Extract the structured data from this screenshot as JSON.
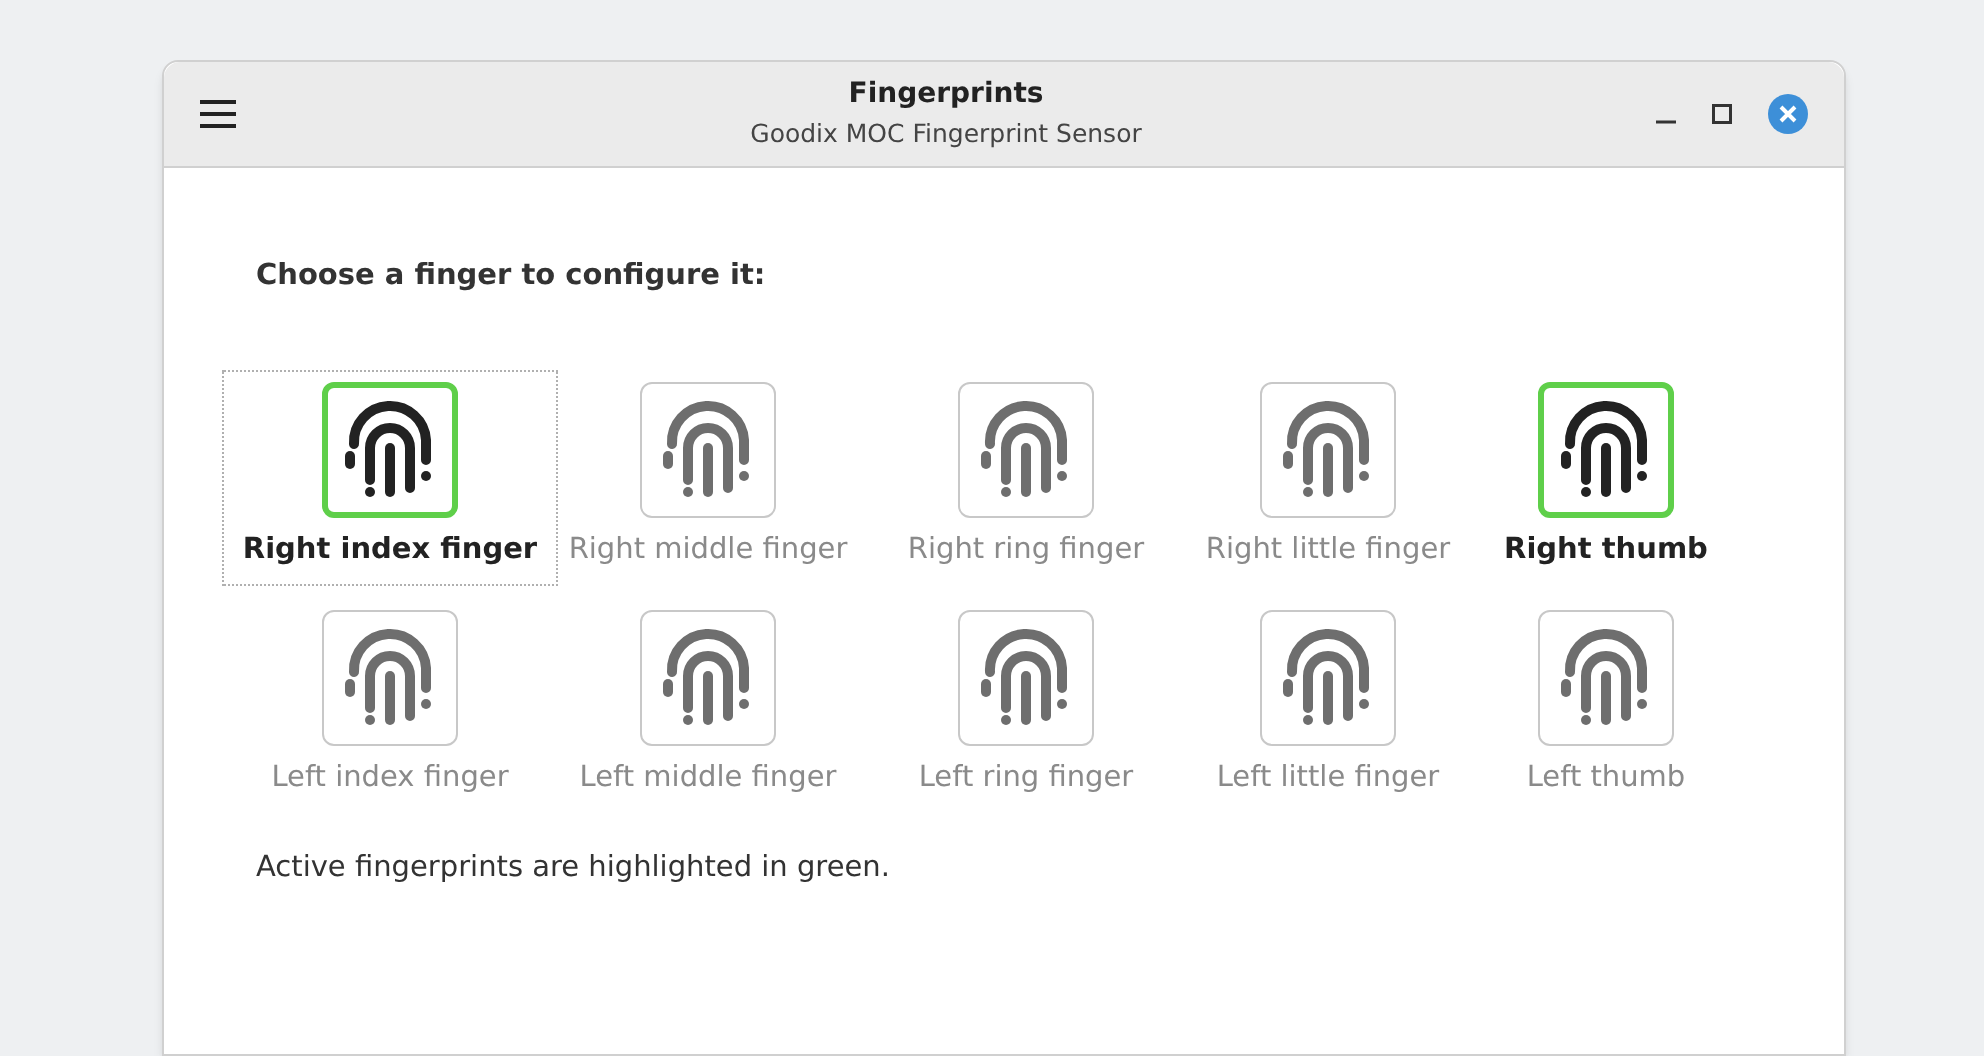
{
  "window": {
    "title": "Fingerprints",
    "subtitle": "Goodix MOC Fingerprint Sensor"
  },
  "prompt": "Choose a finger to configure it:",
  "fingers": [
    {
      "label": "Right index finger",
      "active": true,
      "focused": true
    },
    {
      "label": "Right middle finger",
      "active": false,
      "focused": false
    },
    {
      "label": "Right ring finger",
      "active": false,
      "focused": false
    },
    {
      "label": "Right little finger",
      "active": false,
      "focused": false
    },
    {
      "label": "Right thumb",
      "active": true,
      "focused": false
    },
    {
      "label": "Left index finger",
      "active": false,
      "focused": false
    },
    {
      "label": "Left middle finger",
      "active": false,
      "focused": false
    },
    {
      "label": "Left ring finger",
      "active": false,
      "focused": false
    },
    {
      "label": "Left little finger",
      "active": false,
      "focused": false
    },
    {
      "label": "Left thumb",
      "active": false,
      "focused": false
    }
  ],
  "note": "Active fingerprints are highlighted in green."
}
